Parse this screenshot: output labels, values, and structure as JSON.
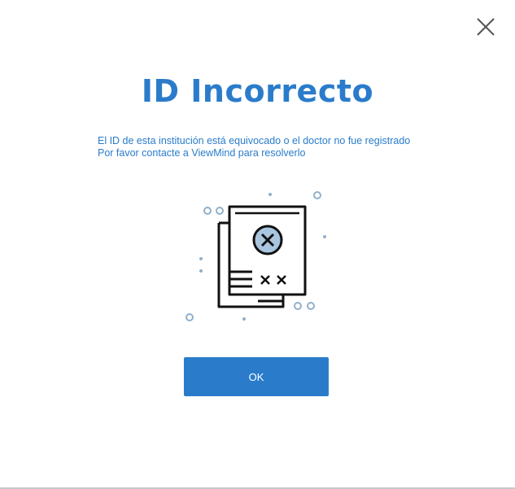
{
  "dialog": {
    "title": "ID Incorrecto",
    "message_line_1": "El ID de esta institución está equivocado o el doctor no fue registrado",
    "message_line_2": "Por favor contacte a ViewMind para resolverlo",
    "ok_label": "OK",
    "close_icon": "close-icon",
    "illustration_icon": "invalid-document-icon"
  },
  "colors": {
    "accent": "#2a7ccb",
    "illustration_stroke": "#111111",
    "illustration_fill": "#a9c6e0",
    "decor_dots": "#8fb0cc"
  }
}
